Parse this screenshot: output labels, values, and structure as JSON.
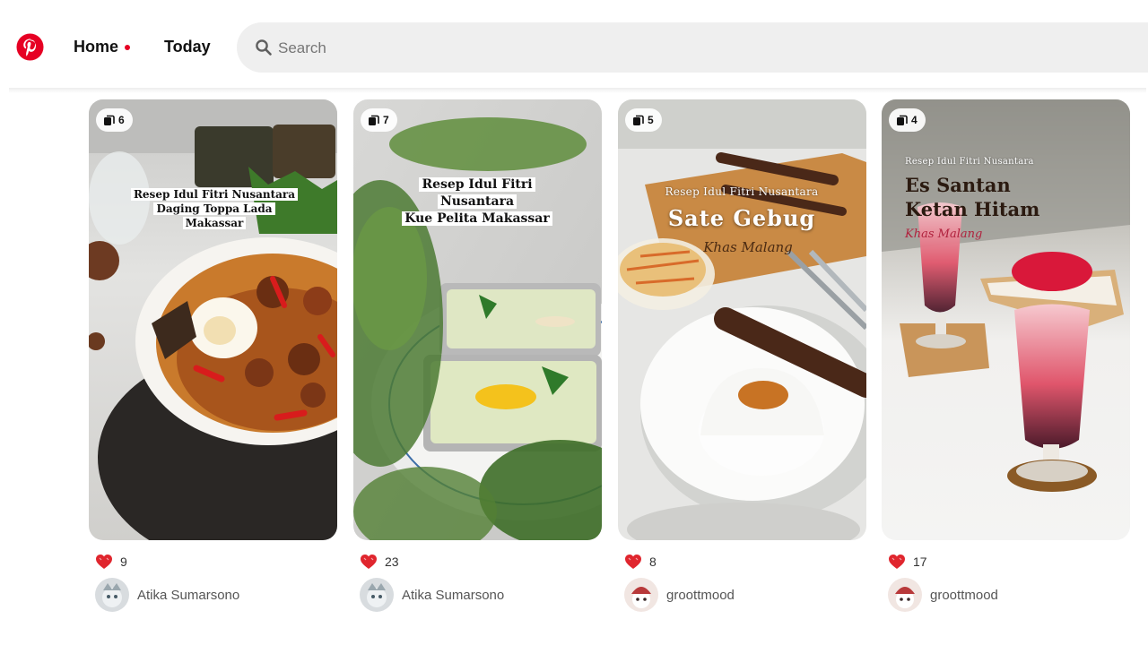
{
  "header": {
    "nav": {
      "home": "Home",
      "today": "Today"
    },
    "search": {
      "placeholder": "Search"
    },
    "accent_color": "#e60023"
  },
  "pins": [
    {
      "slides": "6",
      "overlay": [
        "Resep Idul Fitri Nusantara",
        "Daging Toppa Lada",
        "Makassar"
      ],
      "likes": "9",
      "author": "Atika Sumarsono"
    },
    {
      "slides": "7",
      "overlay": [
        "Resep Idul Fitri",
        "Nusantara",
        "Kue Pelita Makassar"
      ],
      "likes": "23",
      "author": "Atika Sumarsono"
    },
    {
      "slides": "5",
      "overlay": [
        "Resep Idul Fitri Nusantara",
        "Sate Gebug",
        "Khas Malang"
      ],
      "likes": "8",
      "author": "groottmood"
    },
    {
      "slides": "4",
      "overlay": [
        "Resep Idul Fitri Nusantara",
        "Es Santan",
        "Ketan Hitam",
        "Khas Malang"
      ],
      "likes": "17",
      "author": "groottmood"
    }
  ],
  "icons": {
    "logo": "pinterest-logo",
    "search": "search-icon",
    "slides_badge": "stack-icon",
    "likes": "heart-reaction-icon"
  }
}
